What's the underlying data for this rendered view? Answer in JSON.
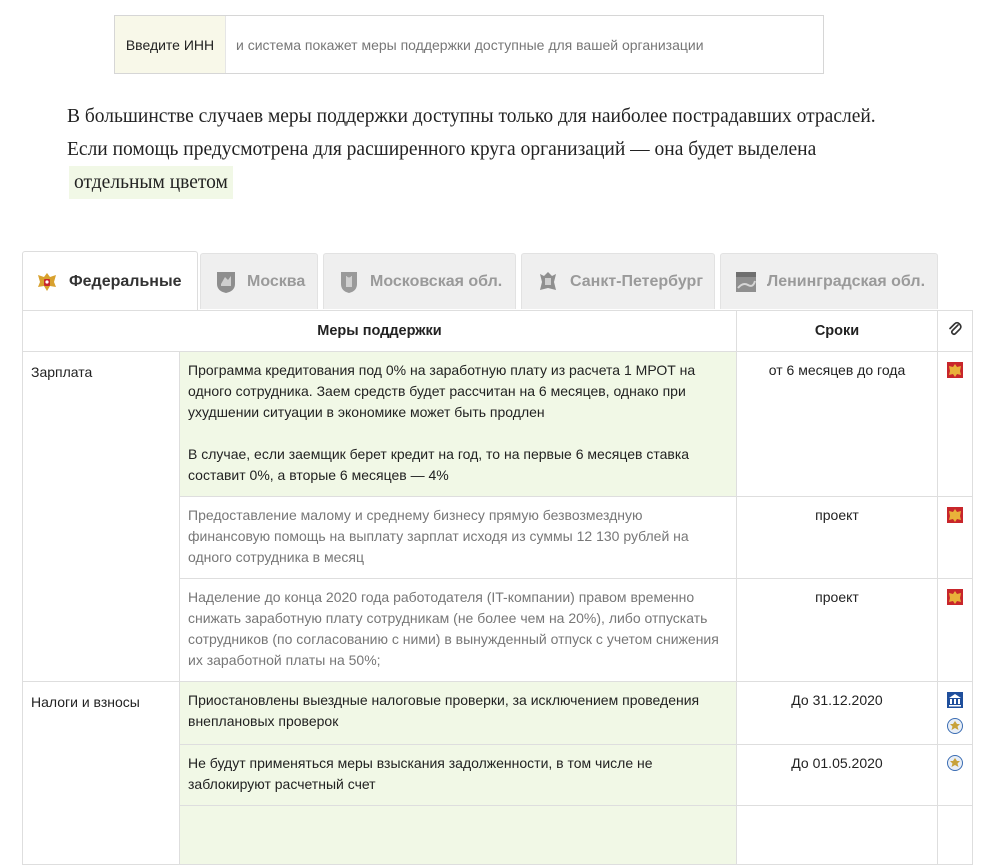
{
  "search": {
    "label": "Введите ИНН",
    "placeholder": "и система покажет меры поддержки доступные для вашей организации"
  },
  "intro": {
    "text": "В большинстве случаев меры поддержки доступны только для наиболее пострадавших отраслей. Если помощь предусмотрена для расширенного круга организаций — она будет выделена",
    "highlight": "отдельным цветом"
  },
  "tabs": [
    {
      "label": "Федеральные",
      "icon": "russia-emblem-icon",
      "active": true
    },
    {
      "label": "Москва",
      "icon": "moscow-emblem-icon",
      "active": false
    },
    {
      "label": "Московская обл.",
      "icon": "moscow-oblast-emblem-icon",
      "active": false
    },
    {
      "label": "Санкт-Петербург",
      "icon": "spb-emblem-icon",
      "active": false
    },
    {
      "label": "Ленинградская обл.",
      "icon": "leningrad-oblast-emblem-icon",
      "active": false
    }
  ],
  "table": {
    "headers": {
      "measures": "Меры поддержки",
      "deadline": "Сроки",
      "source": "paperclip-icon"
    },
    "rows": [
      {
        "category": "Зарплата",
        "measure": "Программа кредитования под 0% на заработную плату из расчета 1 МРОТ на одного сотрудника. Заем средств будет рассчитан на 6 месяцев, однако при ухудшении ситуации в экономике может быть продлен",
        "measure_extra": "В случае, если заемщик берет кредит на год, то на первые 6 месяцев ставка составит 0%, а вторые 6 месяцев — 4%",
        "deadline": "от 6 месяцев до года",
        "wide": true,
        "sources": [
          "russia-emblem-icon"
        ]
      },
      {
        "category": "",
        "measure": "Предоставление малому и среднему бизнесу прямую безвозмездную финансовую помощь на выплату зарплат исходя из суммы 12 130 рублей на одного сотрудника в месяц",
        "deadline": "проект",
        "wide": false,
        "sources": [
          "russia-emblem-icon"
        ]
      },
      {
        "category": "",
        "measure": "Наделение до конца 2020 года работодателя (IT-компании) правом временно снижать заработную плату сотрудникам (не более чем на 20%), либо отпускать сотрудников (по согласованию с ними) в вынужденный отпуск с учетом снижения их заработной платы на 50%;",
        "deadline": "проект",
        "wide": false,
        "sources": [
          "russia-emblem-icon"
        ]
      },
      {
        "category": "Налоги и взносы",
        "measure": "Приостановлены выездные налоговые проверки, за исключением проведения внеплановых проверок",
        "deadline": "До 31.12.2020",
        "wide": true,
        "sources": [
          "government-building-icon",
          "tax-service-icon"
        ]
      },
      {
        "category": "",
        "measure": "Не будут применяться меры взыскания задолженности, в том числе не заблокируют расчетный счет",
        "deadline": "До 01.05.2020",
        "wide": true,
        "sources": [
          "tax-service-icon"
        ]
      }
    ]
  },
  "colors": {
    "wide_highlight": "#f1f8e6",
    "inn_label_bg": "#f8f8e9",
    "inactive_tab_bg": "#efefef",
    "border": "#dedede"
  }
}
